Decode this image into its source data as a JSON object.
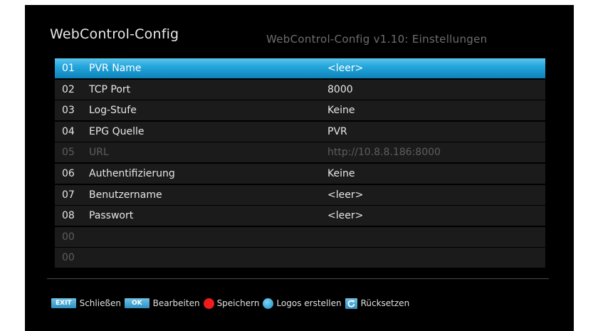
{
  "header": {
    "title": "WebControl-Config",
    "subtitle": "WebControl-Config v1.10: Einstellungen"
  },
  "rows": [
    {
      "num": "01",
      "label": "PVR Name",
      "value": "<leer>",
      "state": "selected"
    },
    {
      "num": "02",
      "label": "TCP Port",
      "value": "8000",
      "state": "normal"
    },
    {
      "num": "03",
      "label": "Log-Stufe",
      "value": "Keine",
      "state": "normal"
    },
    {
      "num": "04",
      "label": "EPG Quelle",
      "value": "PVR",
      "state": "normal"
    },
    {
      "num": "05",
      "label": "URL",
      "value": "http://10.8.8.186:8000",
      "state": "disabled"
    },
    {
      "num": "06",
      "label": "Authentifizierung",
      "value": "Keine",
      "state": "normal"
    },
    {
      "num": "07",
      "label": "Benutzername",
      "value": "<leer>",
      "state": "normal"
    },
    {
      "num": "08",
      "label": "Passwort",
      "value": "<leer>",
      "state": "normal"
    },
    {
      "num": "00",
      "label": "",
      "value": "",
      "state": "disabled"
    },
    {
      "num": "00",
      "label": "",
      "value": "",
      "state": "disabled"
    }
  ],
  "footer": {
    "exit_key": "EXIT",
    "exit_label": "Schließen",
    "ok_key": "OK",
    "ok_label": "Bearbeiten",
    "red_label": "Speichern",
    "blue_label": "Logos erstellen",
    "reset_label": "Rücksetzen"
  },
  "colors": {
    "selected": "#25a6dc",
    "row_background": "#1b1b1b",
    "disabled_text": "#5e5e5e",
    "red_button": "#ee1c1c",
    "blue_button": "#1a8fc4"
  }
}
